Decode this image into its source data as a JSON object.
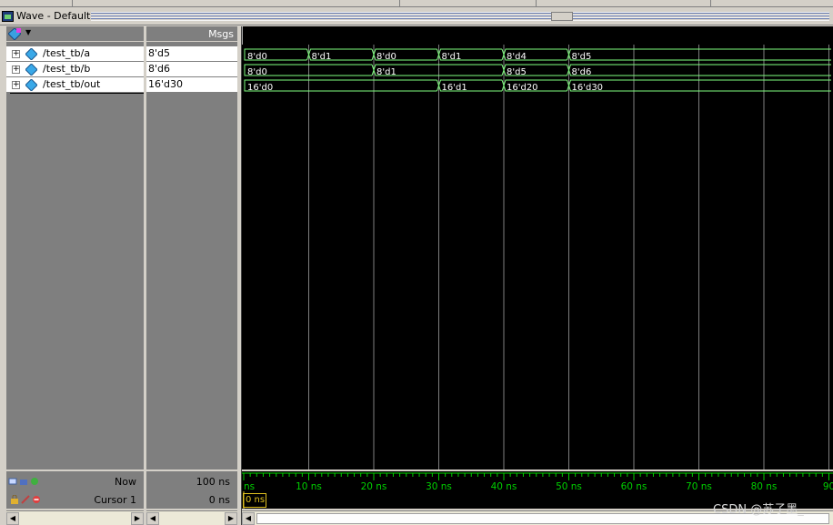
{
  "window": {
    "title": "Wave - Default"
  },
  "header": {
    "msgs_label": "Msgs"
  },
  "signals": [
    {
      "name": "/test_tb/a",
      "value": "8'd5"
    },
    {
      "name": "/test_tb/b",
      "value": "8'd6"
    },
    {
      "name": "/test_tb/out",
      "value": "16'd30"
    }
  ],
  "waves": [
    {
      "segments": [
        {
          "t": 0,
          "label": "8'd0"
        },
        {
          "t": 10,
          "label": "8'd1"
        },
        {
          "t": 20,
          "label": "8'd0"
        },
        {
          "t": 30,
          "label": "8'd1"
        },
        {
          "t": 40,
          "label": "8'd4"
        },
        {
          "t": 50,
          "label": "8'd5"
        }
      ]
    },
    {
      "segments": [
        {
          "t": 0,
          "label": "8'd0"
        },
        {
          "t": 20,
          "label": "8'd1"
        },
        {
          "t": 40,
          "label": "8'd5"
        },
        {
          "t": 50,
          "label": "8'd6"
        }
      ]
    },
    {
      "segments": [
        {
          "t": 0,
          "label": "16'd0"
        },
        {
          "t": 30,
          "label": "16'd1"
        },
        {
          "t": 40,
          "label": "16'd20"
        },
        {
          "t": 50,
          "label": "16'd30"
        }
      ]
    }
  ],
  "timeline": {
    "ticks": [
      {
        "t": 0,
        "label": "ns"
      },
      {
        "t": 10,
        "label": "10 ns"
      },
      {
        "t": 20,
        "label": "20 ns"
      },
      {
        "t": 30,
        "label": "30 ns"
      },
      {
        "t": 40,
        "label": "40 ns"
      },
      {
        "t": 50,
        "label": "50 ns"
      },
      {
        "t": 60,
        "label": "60 ns"
      },
      {
        "t": 70,
        "label": "70 ns"
      },
      {
        "t": 80,
        "label": "80 ns"
      },
      {
        "t": 90,
        "label": "90"
      }
    ]
  },
  "status": {
    "now_label": "Now",
    "now_value": "100 ns",
    "cursor_label": "Cursor 1",
    "cursor_value": "0 ns",
    "cursor_box": "0 ns"
  },
  "watermark": "CSDN @苏子墨_",
  "colors": {
    "wave": "#7fff7f",
    "label": "#ffffff",
    "timeline": "#00d000",
    "cursor": "#e0c020",
    "grid": "#7f7f7f"
  }
}
